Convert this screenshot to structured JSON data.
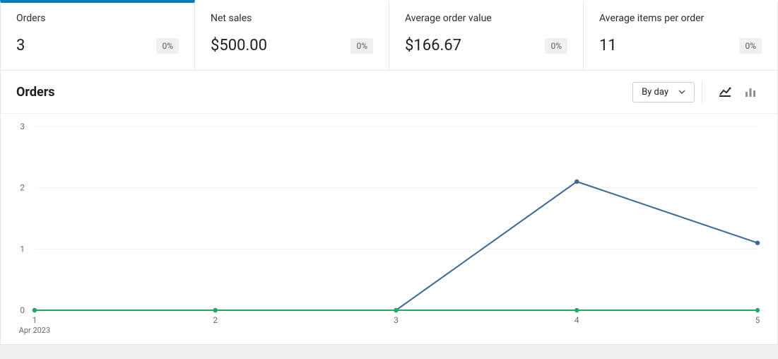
{
  "stats": [
    {
      "label": "Orders",
      "value": "3",
      "change": "0%",
      "active": true
    },
    {
      "label": "Net sales",
      "value": "$500.00",
      "change": "0%",
      "active": false
    },
    {
      "label": "Average order value",
      "value": "$166.67",
      "change": "0%",
      "active": false
    },
    {
      "label": "Average items per order",
      "value": "11",
      "change": "0%",
      "active": false
    }
  ],
  "chart": {
    "title": "Orders",
    "interval_label": "By day"
  },
  "chart_data": {
    "type": "line",
    "title": "Orders",
    "xlabel": "",
    "ylabel": "",
    "ylim": [
      0,
      3
    ],
    "x": [
      1,
      2,
      3,
      4,
      5
    ],
    "x_sublabels": {
      "1": "Apr 2023"
    },
    "y_ticks": [
      0,
      1,
      2,
      3
    ],
    "series": [
      {
        "name": "current",
        "color": "#3d6894",
        "values": [
          0,
          0,
          0,
          2.1,
          1.1
        ]
      },
      {
        "name": "previous",
        "color": "#24a862",
        "values": [
          0,
          0,
          0,
          0,
          0
        ]
      }
    ]
  }
}
